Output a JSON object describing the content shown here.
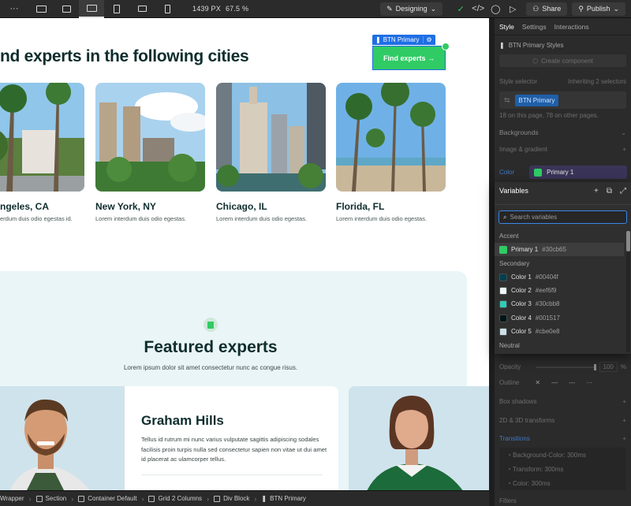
{
  "topbar": {
    "readout_px": "1439 PX",
    "readout_zoom": "67.5 %",
    "mode_label": "Designing",
    "share_label": "Share",
    "publish_label": "Publish"
  },
  "canvas": {
    "heading": "nd experts in the following cities",
    "button_tag": "BTN Primary",
    "find_button": "Find experts →",
    "cities": [
      {
        "name": "ngeles, CA",
        "text": "erdum duis odio egestas id."
      },
      {
        "name": "New York, NY",
        "text": "Lorem interdum duis odio egestas."
      },
      {
        "name": "Chicago, IL",
        "text": "Lorem interdum duis odio egestas."
      },
      {
        "name": "Florida, FL",
        "text": "Lorem interdum duis odio egestas."
      }
    ],
    "featured_title": "Featured experts",
    "featured_sub": "Lorem ipsum dolor sit amet consectetur nunc ac congue risus.",
    "expert_name": "Graham Hills",
    "expert_bio": "Tellus id rutrum mi nunc varius vulputate sagittis adipiscing sodales facilisis proin turpis nulla sed consectetur sapien non vitae ut dui amet id placerat ac ulamcorper tellus."
  },
  "breadcrumb": [
    "Wrapper",
    "Section",
    "Container Default",
    "Grid 2 Columns",
    "Div Block",
    "BTN Primary"
  ],
  "panel": {
    "tabs": [
      "Style",
      "Settings",
      "Interactions"
    ],
    "styles_title": "BTN Primary Styles",
    "create_component": "Create component",
    "style_selector": "Style selector",
    "inheriting": "Inheriting 2 selectors",
    "selector_chip": "BTN Primary",
    "page_info": "18 on this page, 78 on other pages.",
    "backgrounds": "Backgrounds",
    "image_gradient": "Image & gradient",
    "color_label": "Color",
    "color_value": "Primary 1",
    "opacity": "Opacity",
    "opacity_value": "100",
    "opacity_unit": "%",
    "outline": "Outline",
    "box_shadows": "Box shadows",
    "transforms": "2D & 3D transforms",
    "transitions": "Transitions",
    "transition_items": [
      "Background-Color: 300ms",
      "Transform: 300ms",
      "Color: 300ms"
    ],
    "filters": "Filters"
  },
  "variables": {
    "title": "Variables",
    "search_placeholder": "Search variables",
    "group_accent": "Accent",
    "group_secondary": "Secondary",
    "group_neutral": "Neutral",
    "accent": [
      {
        "name": "Primary 1",
        "hex": "#30cb65"
      }
    ],
    "secondary": [
      {
        "name": "Color 1",
        "hex": "#00404f"
      },
      {
        "name": "Color 2",
        "hex": "#eef6f9"
      },
      {
        "name": "Color 3",
        "hex": "#30cbb8"
      },
      {
        "name": "Color 4",
        "hex": "#001517"
      },
      {
        "name": "Color 5",
        "hex": "#cbe0e8"
      }
    ]
  },
  "colors": {
    "primary": "#30cb65",
    "selection": "#1f6fe5"
  }
}
